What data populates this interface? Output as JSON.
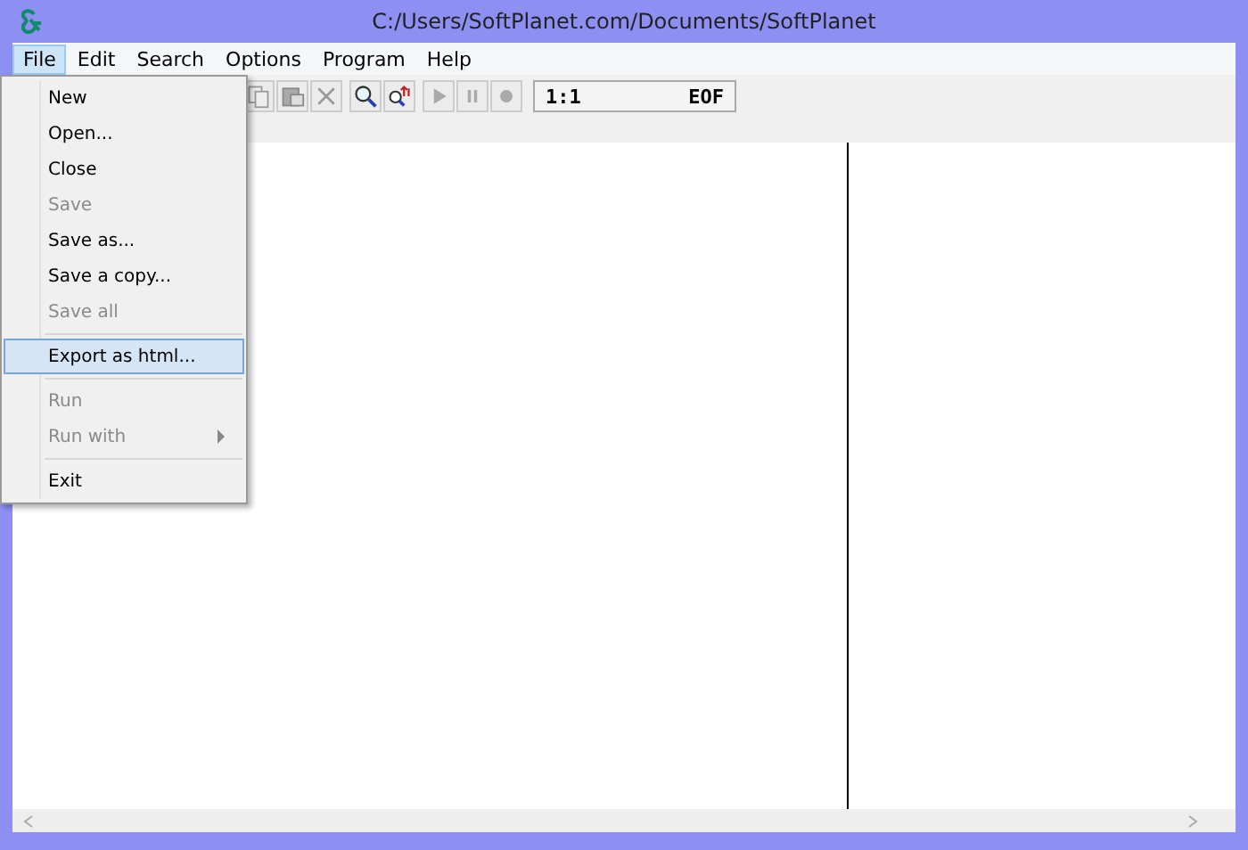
{
  "window": {
    "title": "C:/Users/SoftPlanet.com/Documents/SoftPlanet"
  },
  "menu_bar": [
    {
      "label": "File",
      "selected": true
    },
    {
      "label": "Edit",
      "selected": false
    },
    {
      "label": "Search",
      "selected": false
    },
    {
      "label": "Options",
      "selected": false
    },
    {
      "label": "Program",
      "selected": false
    },
    {
      "label": "Help",
      "selected": false
    }
  ],
  "file_menu": [
    {
      "kind": "item",
      "label": "New",
      "disabled": false,
      "selected": false
    },
    {
      "kind": "item",
      "label": "Open...",
      "disabled": false,
      "selected": false
    },
    {
      "kind": "item",
      "label": "Close",
      "disabled": false,
      "selected": false
    },
    {
      "kind": "item",
      "label": "Save",
      "disabled": true,
      "selected": false
    },
    {
      "kind": "item",
      "label": "Save as...",
      "disabled": false,
      "selected": false
    },
    {
      "kind": "item",
      "label": "Save a copy...",
      "disabled": false,
      "selected": false
    },
    {
      "kind": "item",
      "label": "Save all",
      "disabled": true,
      "selected": false
    },
    {
      "kind": "separator"
    },
    {
      "kind": "item",
      "label": "Export as html...",
      "disabled": false,
      "selected": true
    },
    {
      "kind": "separator"
    },
    {
      "kind": "item",
      "label": "Run",
      "disabled": true,
      "selected": false
    },
    {
      "kind": "submenu",
      "label": "Run with",
      "disabled": true,
      "selected": false
    },
    {
      "kind": "separator"
    },
    {
      "kind": "item",
      "label": "Exit",
      "disabled": false,
      "selected": false
    }
  ],
  "status": {
    "position": "1:1",
    "state": "EOF"
  }
}
